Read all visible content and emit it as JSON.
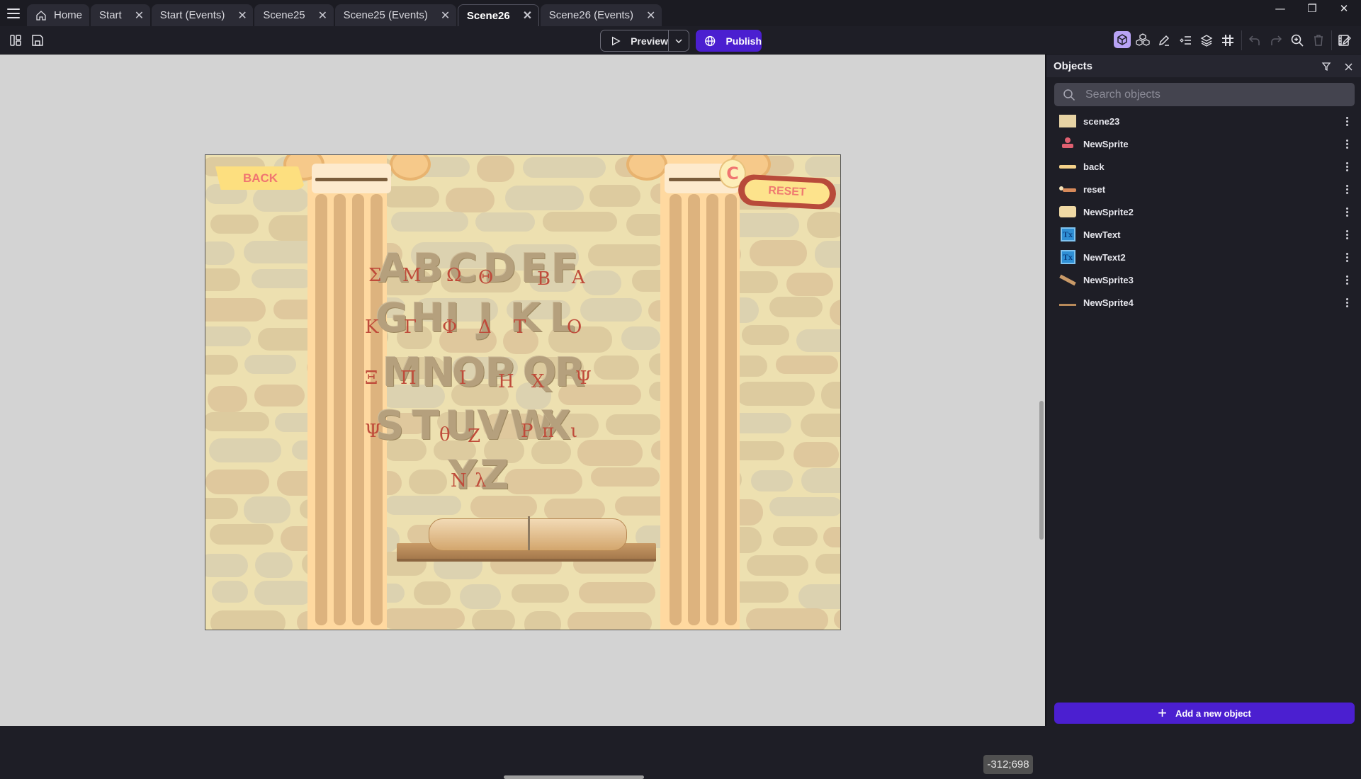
{
  "tabs": [
    {
      "label": "Home",
      "icon": "home-icon",
      "closable": false,
      "active": false
    },
    {
      "label": "Start",
      "closable": true,
      "active": false
    },
    {
      "label": "Start (Events)",
      "closable": true,
      "active": false
    },
    {
      "label": "Scene25",
      "closable": true,
      "active": false
    },
    {
      "label": "Scene25 (Events)",
      "closable": true,
      "active": false
    },
    {
      "label": "Scene26",
      "closable": true,
      "active": true
    },
    {
      "label": "Scene26 (Events)",
      "closable": true,
      "active": false
    }
  ],
  "tab_close_glyph": "✕",
  "window_controls": {
    "minimize": "—",
    "restore": "❐",
    "close": "✕"
  },
  "toolbar": {
    "preview_label": "Preview",
    "publish_label": "Publish",
    "right_icons": [
      "object-editor-icon",
      "object-groups-icon",
      "edit-properties-icon",
      "instances-list-icon",
      "layers-icon",
      "grid-icon",
      "undo-icon",
      "redo-icon",
      "zoom-icon",
      "delete-icon",
      "scene-properties-icon"
    ]
  },
  "scene": {
    "back_label": "BACK",
    "reset_label": "RESET",
    "refresh_glyph": "C",
    "latin_letters": [
      {
        "ch": "A"
      },
      {
        "ch": "B"
      },
      {
        "ch": "C"
      },
      {
        "ch": "D"
      },
      {
        "ch": "E"
      },
      {
        "ch": "F"
      },
      {
        "ch": "G"
      },
      {
        "ch": "H"
      },
      {
        "ch": "I"
      },
      {
        "ch": "J"
      },
      {
        "ch": "K"
      },
      {
        "ch": "L"
      },
      {
        "ch": "M"
      },
      {
        "ch": "N"
      },
      {
        "ch": "O"
      },
      {
        "ch": "P"
      },
      {
        "ch": "Q"
      },
      {
        "ch": "R"
      },
      {
        "ch": "S"
      },
      {
        "ch": "T"
      },
      {
        "ch": "U"
      },
      {
        "ch": "V"
      },
      {
        "ch": "W"
      },
      {
        "ch": "X"
      },
      {
        "ch": "Y"
      },
      {
        "ch": "Z"
      }
    ],
    "greek_letters": [
      {
        "ch": "Σ"
      },
      {
        "ch": "Μ"
      },
      {
        "ch": "Ω"
      },
      {
        "ch": "Θ"
      },
      {
        "ch": "Β"
      },
      {
        "ch": "Α"
      },
      {
        "ch": "Κ"
      },
      {
        "ch": "Γ"
      },
      {
        "ch": "Φ"
      },
      {
        "ch": "Δ"
      },
      {
        "ch": "Τ"
      },
      {
        "ch": "Ο"
      },
      {
        "ch": "Ξ"
      },
      {
        "ch": "Π"
      },
      {
        "ch": "Ι"
      },
      {
        "ch": "Η"
      },
      {
        "ch": "Χ"
      },
      {
        "ch": "Ψ"
      },
      {
        "ch": "Ψ"
      },
      {
        "ch": "θ"
      },
      {
        "ch": "Ζ"
      },
      {
        "ch": "Ρ"
      },
      {
        "ch": "π"
      },
      {
        "ch": "ι"
      },
      {
        "ch": "Ν"
      },
      {
        "ch": "λ"
      }
    ]
  },
  "cursor_coordinates": "-312;698",
  "objects_panel": {
    "title": "Objects",
    "search_placeholder": "Search objects",
    "items": [
      {
        "name": "scene23",
        "thumb": "background-thumb"
      },
      {
        "name": "NewSprite",
        "thumb": "reset-sprite-thumb"
      },
      {
        "name": "back",
        "thumb": "back-button-thumb"
      },
      {
        "name": "reset",
        "thumb": "reset-button-thumb"
      },
      {
        "name": "NewSprite2",
        "thumb": "parchment-thumb"
      },
      {
        "name": "NewText",
        "thumb": "text-object-thumb"
      },
      {
        "name": "NewText2",
        "thumb": "text-object-thumb"
      },
      {
        "name": "NewSprite3",
        "thumb": "plank-diagonal-thumb"
      },
      {
        "name": "NewSprite4",
        "thumb": "plank-thumb"
      }
    ],
    "add_button_label": "Add a new object"
  }
}
